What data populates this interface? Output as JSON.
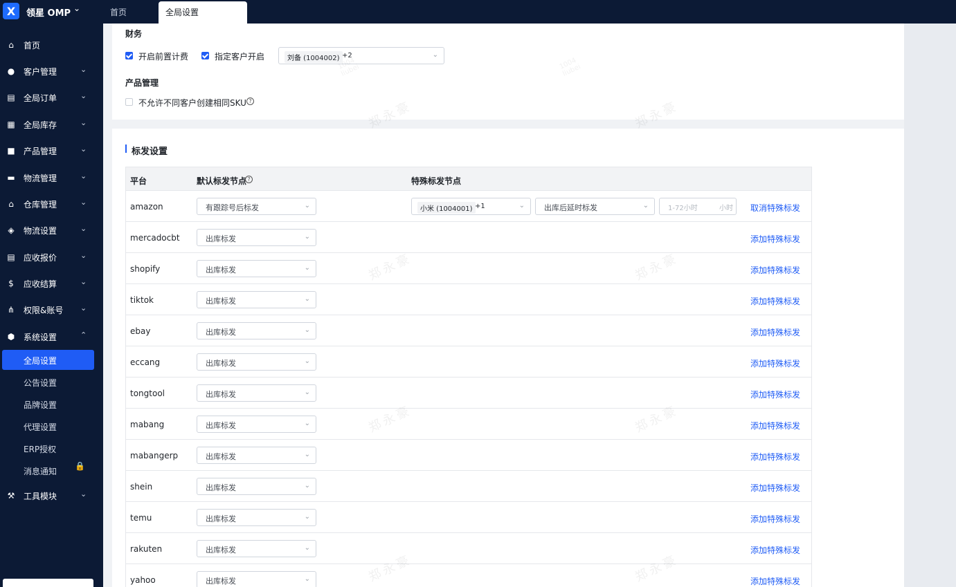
{
  "app": {
    "logo": "X",
    "name": "领星 OMP"
  },
  "tabs": [
    {
      "label": "首页"
    },
    {
      "label": "全局设置"
    }
  ],
  "sidebar": {
    "items": [
      {
        "label": "首页",
        "icon": "home-icon"
      },
      {
        "label": "客户管理",
        "icon": "users-icon"
      },
      {
        "label": "全局订单",
        "icon": "clipboard-icon"
      },
      {
        "label": "全局库存",
        "icon": "warehouse-icon"
      },
      {
        "label": "产品管理",
        "icon": "bag-icon"
      },
      {
        "label": "物流管理",
        "icon": "truck-icon"
      },
      {
        "label": "仓库管理",
        "icon": "house-icon"
      },
      {
        "label": "物流设置",
        "icon": "box-icon"
      },
      {
        "label": "应收报价",
        "icon": "document-icon"
      },
      {
        "label": "应收结算",
        "icon": "dollar-icon"
      },
      {
        "label": "权限&账号",
        "icon": "org-chart-icon"
      },
      {
        "label": "系统设置",
        "icon": "hexagon-icon"
      },
      {
        "label": "工具模块",
        "icon": "wrench-icon"
      }
    ],
    "sub_items": [
      {
        "label": "全局设置"
      },
      {
        "label": "公告设置"
      },
      {
        "label": "品牌设置"
      },
      {
        "label": "代理设置"
      },
      {
        "label": "ERP授权"
      },
      {
        "label": "消息通知"
      }
    ]
  },
  "finance": {
    "title": "财务",
    "prepaid_label": "开启前置计费",
    "prepaid_checked": true,
    "specific_label": "指定客户开启",
    "specific_checked": true,
    "customer_tag": "刘备 (1004002)",
    "customer_more": "+2"
  },
  "product": {
    "title": "产品管理",
    "sku_label": "不允许不同客户创建相同SKU",
    "sku_checked": false
  },
  "shipping": {
    "title": "标发设置",
    "col_platform": "平台",
    "col_default": "默认标发节点",
    "col_special": "特殊标发节点",
    "special_customer": "小米 (1004001)",
    "special_more": "+1",
    "special_mode": "出库后延时标发",
    "hours_placeholder": "1-72小时",
    "hours_unit": "小时",
    "rows": [
      {
        "platform": "amazon",
        "default": "有跟踪号后标发",
        "action": "取消特殊标发"
      },
      {
        "platform": "mercadocbt",
        "default": "出库标发",
        "action": "添加特殊标发"
      },
      {
        "platform": "shopify",
        "default": "出库标发",
        "action": "添加特殊标发"
      },
      {
        "platform": "tiktok",
        "default": "出库标发",
        "action": "添加特殊标发"
      },
      {
        "platform": "ebay",
        "default": "出库标发",
        "action": "添加特殊标发"
      },
      {
        "platform": "eccang",
        "default": "出库标发",
        "action": "添加特殊标发"
      },
      {
        "platform": "tongtool",
        "default": "出库标发",
        "action": "添加特殊标发"
      },
      {
        "platform": "mabang",
        "default": "出库标发",
        "action": "添加特殊标发"
      },
      {
        "platform": "mabangerp",
        "default": "出库标发",
        "action": "添加特殊标发"
      },
      {
        "platform": "shein",
        "default": "出库标发",
        "action": "添加特殊标发"
      },
      {
        "platform": "temu",
        "default": "出库标发",
        "action": "添加特殊标发"
      },
      {
        "platform": "rakuten",
        "default": "出库标发",
        "action": "添加特殊标发"
      },
      {
        "platform": "yahoo",
        "default": "出库标发",
        "action": "添加特殊标发"
      }
    ]
  },
  "watermark": {
    "id": "1004",
    "name": "liubei",
    "owner": "郑永豪"
  },
  "colors": {
    "sidebar_bg": "#0c1a35",
    "accent": "#1f5cf5"
  }
}
